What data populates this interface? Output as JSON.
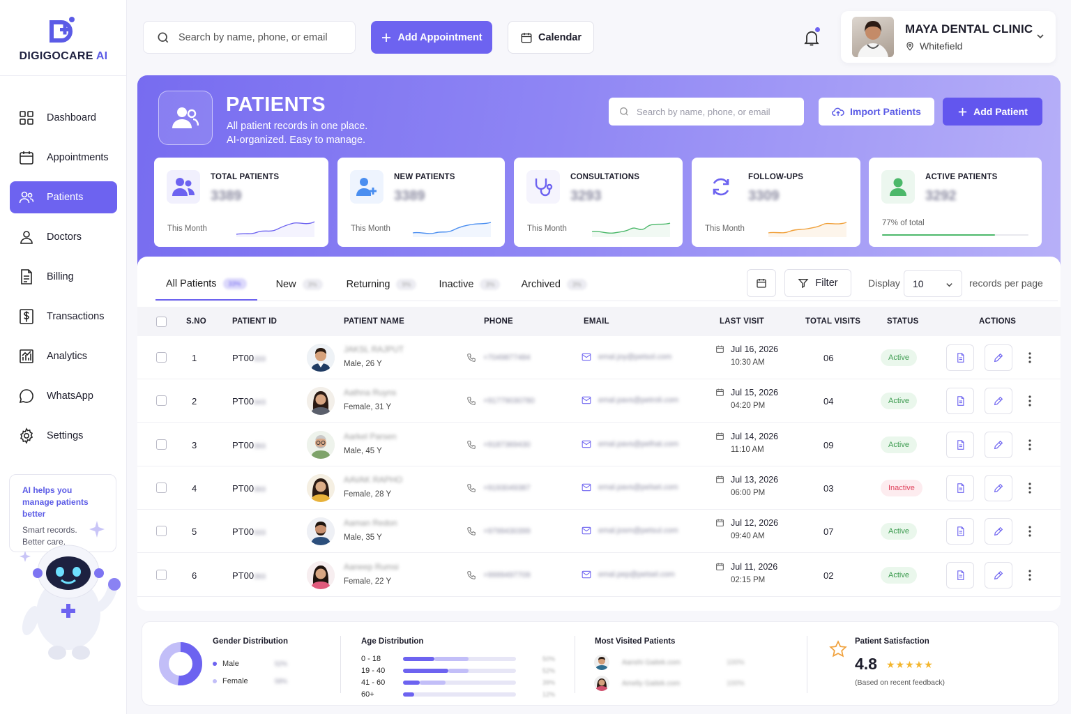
{
  "brand": {
    "name_part1": "DIGIGOCARE",
    "name_part2": "AI",
    "accent": "#6d63f0"
  },
  "sidebar": {
    "items": [
      {
        "label": "Dashboard",
        "icon": "grid-icon"
      },
      {
        "label": "Appointments",
        "icon": "calendar-icon"
      },
      {
        "label": "Patients",
        "icon": "users-icon",
        "active": true
      },
      {
        "label": "Doctors",
        "icon": "user-icon"
      },
      {
        "label": "Billing",
        "icon": "document-icon"
      },
      {
        "label": "Transactions",
        "icon": "dollar-receipt-icon"
      },
      {
        "label": "Analytics",
        "icon": "bar-chart-icon"
      },
      {
        "label": "WhatsApp",
        "icon": "chat-icon"
      },
      {
        "label": "Settings",
        "icon": "gear-icon"
      }
    ],
    "ai_card": {
      "title": "AI helps you manage patients better",
      "subtitle_line1": "Smart records.",
      "subtitle_line2": "Better care."
    }
  },
  "topbar": {
    "search_placeholder": "Search by name, phone, or email",
    "add_appointment": "Add Appointment",
    "calendar": "Calendar",
    "clinic_name": "MAYA DENTAL CLINIC",
    "clinic_location": "Whitefield"
  },
  "hero": {
    "title": "PATIENTS",
    "subtitle_line1": "All patient records in one place.",
    "subtitle_line2": "AI-organized. Easy to manage.",
    "search_placeholder": "Search by name, phone, or email",
    "import_label": "Import Patients",
    "add_label": "Add Patient"
  },
  "stats": [
    {
      "label": "TOTAL PATIENTS",
      "value": "3389",
      "foot": "This Month",
      "color": "#6d63f0"
    },
    {
      "label": "NEW PATIENTS",
      "value": "3389",
      "foot": "This Month",
      "color": "#4a8ef0"
    },
    {
      "label": "CONSULTATIONS",
      "value": "3293",
      "foot": "This Month",
      "color": "#4cb86a"
    },
    {
      "label": "FOLLOW-UPS",
      "value": "3309",
      "foot": "This Month",
      "color": "#f0a03a"
    },
    {
      "label": "ACTIVE PATIENTS",
      "value": "3292",
      "foot": "77% of total",
      "color": "#4cb86a",
      "progress": 0.77
    }
  ],
  "tabs": [
    {
      "label": "All Patients",
      "count": "33%",
      "active": true
    },
    {
      "label": "New",
      "count": "3%"
    },
    {
      "label": "Returning",
      "count": "9%"
    },
    {
      "label": "Inactive",
      "count": "3%"
    },
    {
      "label": "Archived",
      "count": "3%"
    }
  ],
  "controls": {
    "filter": "Filter",
    "display_label": "Display",
    "per_page": "10",
    "per_page_suffix": "records per page"
  },
  "columns": [
    "S.NO",
    "PATIENT ID",
    "PATIENT NAME",
    "PHONE",
    "EMAIL",
    "LAST VISIT",
    "TOTAL VISITS",
    "STATUS",
    "ACTIONS"
  ],
  "rows": [
    {
      "sno": "1",
      "pid": "PT00",
      "pid_hidden": "333",
      "name": "JAKSL RAJPUT",
      "gender": "Male, 26 Y",
      "phone": "+7049877484",
      "email": "emal.joy@petsol.com",
      "date": "Jul 16, 2026",
      "time": "10:30 AM",
      "visits": "06",
      "status": "Active",
      "avatar": "male-avatar-1"
    },
    {
      "sno": "2",
      "pid": "PT00",
      "pid_hidden": "343",
      "name": "Aathna Ruyns",
      "gender": "Female, 31 Y",
      "phone": "+91779030780",
      "email": "emal.pavs@petroli.com",
      "date": "Jul 15, 2026",
      "time": "04:20 PM",
      "visits": "04",
      "status": "Active",
      "avatar": "female-avatar-1"
    },
    {
      "sno": "3",
      "pid": "PT00",
      "pid_hidden": "393",
      "name": "Aarkel Parsen",
      "gender": "Male, 45 Y",
      "phone": "+9187369430",
      "email": "emal.pavs@pelhat.com",
      "date": "Jul 14, 2026",
      "time": "11:10 AM",
      "visits": "09",
      "status": "Active",
      "avatar": "male-avatar-2"
    },
    {
      "sno": "4",
      "pid": "PT00",
      "pid_hidden": "393",
      "name": "AAVAK RAPHO",
      "gender": "Female, 28 Y",
      "phone": "+9193049387",
      "email": "emal.pavs@pelset.com",
      "date": "Jul 13, 2026",
      "time": "06:00 PM",
      "visits": "03",
      "status": "Inactive",
      "avatar": "female-avatar-2"
    },
    {
      "sno": "5",
      "pid": "PT00",
      "pid_hidden": "333",
      "name": "Aaman Redon",
      "gender": "Male, 35 Y",
      "phone": "+9799430399",
      "email": "emal.josm@petsul.com",
      "date": "Jul 12, 2026",
      "time": "09:40 AM",
      "visits": "07",
      "status": "Active",
      "avatar": "male-avatar-3"
    },
    {
      "sno": "6",
      "pid": "PT00",
      "pid_hidden": "393",
      "name": "Aaneep Rumsi",
      "gender": "Female, 22 Y",
      "phone": "+9999497709",
      "email": "emal.pep@petsel.com",
      "date": "Jul 11, 2026",
      "time": "02:15 PM",
      "visits": "02",
      "status": "Active",
      "avatar": "female-avatar-3"
    }
  ],
  "summary": {
    "gender": {
      "title": "Gender Distribution",
      "male_label": "Male",
      "male_pct": "52%",
      "female_label": "Female",
      "female_pct": "58%",
      "male_share": 0.52
    },
    "age": {
      "title": "Age Distribution",
      "groups": [
        {
          "label": "0 - 18",
          "value": 0.28,
          "light": 0.58,
          "pct": "50%"
        },
        {
          "label": "19 - 40",
          "value": 0.4,
          "light": 0.58,
          "pct": "52%"
        },
        {
          "label": "41 - 60",
          "value": 0.15,
          "light": 0.38,
          "pct": "39%"
        },
        {
          "label": "60+",
          "value": 0.1,
          "light": 0.0,
          "pct": "12%"
        }
      ]
    },
    "visited": {
      "title": "Most Visited Patients",
      "items": [
        {
          "name": "Aanshi Gaitek.com",
          "pct": "100%"
        },
        {
          "name": "Ameliy Gaitek.com",
          "pct": "100%"
        }
      ]
    },
    "satisfaction": {
      "title": "Patient Satisfaction",
      "rating": "4.8",
      "stars": "★★★★★",
      "foot": "(Based on recent feedback)"
    }
  }
}
